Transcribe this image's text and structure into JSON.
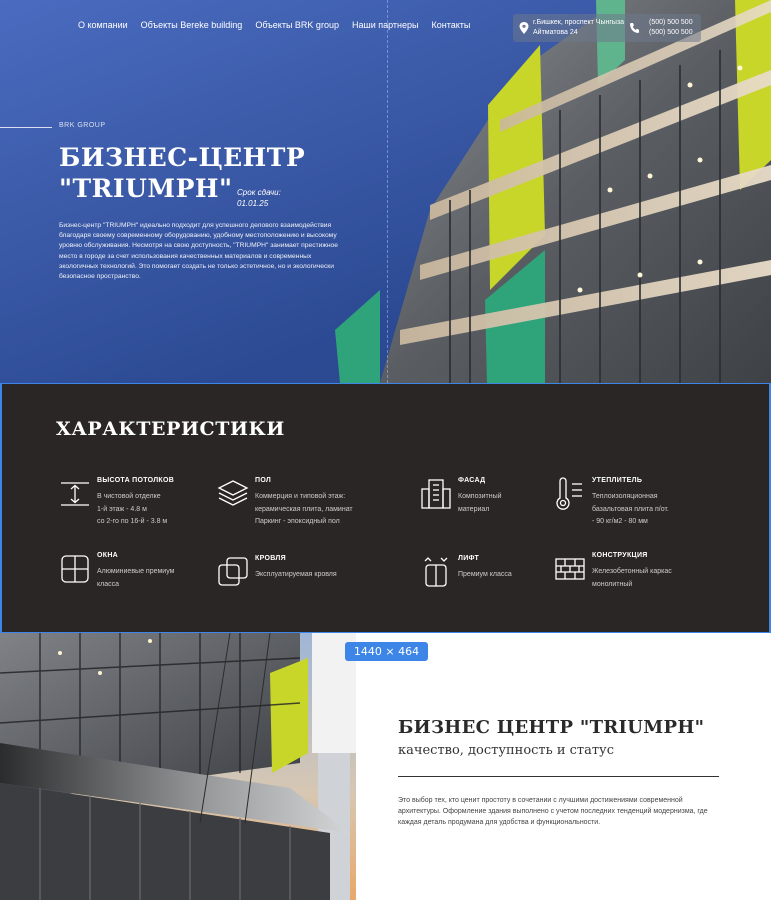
{
  "nav": {
    "items": [
      "О компании",
      "Объекты Bereke building",
      "Объекты BRK group",
      "Наши партнеры",
      "Контакты"
    ]
  },
  "contact": {
    "address": "г.Бишкек, проспект Чынгыза Айтматова 24",
    "phone_1": "(500) 500 500",
    "phone_2": "(500) 500 500"
  },
  "hero": {
    "brand": "BRK GROUP",
    "title": "БИЗНЕС-ЦЕНТР \"TRIUMPH\"",
    "deadline_label": "Срок сдачи:",
    "deadline_date": "01.01.25",
    "description": "Бизнес-центр \"TRIUMPH\" идеально подходит для успешного делового взаимодействия благодаря своему современному оборудованию, удобному местоположению и высокому уровню обслуживания. Несмотря на свою доступность, \"TRIUMPH\" занимает престижное место в городе за счет использования качественных материалов и современных экологичных технологий. Это помогает создать не только эстетичное, но и экологически безопасное пространство."
  },
  "features": {
    "title": "ХАРАКТЕРИСТИКИ",
    "items": [
      {
        "name": "ВЫСОТА ПОТОЛКОВ",
        "lines": [
          "В чистовой отделке",
          "1-й этаж - 4.8 м",
          "со 2-го по 16-й - 3.8 м"
        ],
        "icon": "ceiling-height-icon"
      },
      {
        "name": "ПОЛ",
        "lines": [
          "Коммерция и типовой этаж:",
          "керамическая плита, ламинат",
          "Паркинг - эпоксидный пол"
        ],
        "icon": "floor-layers-icon"
      },
      {
        "name": "ФАСАД",
        "lines": [
          "Композитный",
          "материал"
        ],
        "icon": "facade-building-icon"
      },
      {
        "name": "УТЕПЛИТЕЛЬ",
        "lines": [
          "Теплоизоляционная",
          "базальтовая плита п/от.",
          "- 90 кг/м2 - 80 мм"
        ],
        "icon": "thermometer-icon"
      },
      {
        "name": "ОКНА",
        "lines": [
          "Алюминиевые премиум",
          "класса"
        ],
        "icon": "window-icon"
      },
      {
        "name": "КРОВЛЯ",
        "lines": [
          "Эксплуатируемая кровля"
        ],
        "icon": "roof-icon"
      },
      {
        "name": "ЛИФТ",
        "lines": [
          "Премиум класса"
        ],
        "icon": "elevator-icon"
      },
      {
        "name": "КОНСТРУКЦИЯ",
        "lines": [
          "Железобетонный каркас",
          "монолитный"
        ],
        "icon": "brick-wall-icon"
      }
    ]
  },
  "overlay": {
    "size_label": "1440 × 464"
  },
  "about": {
    "title": "БИЗНЕС ЦЕНТР \"TRIUMPH\"",
    "subtitle": "качество, доступность и статус",
    "text": "Это выбор тех, кто ценит простоту в сочетании с лучшими достижениями современной архитектуры. Оформление здания выполнено с учетом последних тенденций модернизма, где каждая деталь продумана для удобства и функциональности."
  },
  "colors": {
    "hero_blue": "#3b5aa8",
    "features_bg": "#2b2626",
    "accent_yellow": "#c8d62a",
    "accent_green": "#2fa37a",
    "selection_blue": "#3d86e8"
  }
}
